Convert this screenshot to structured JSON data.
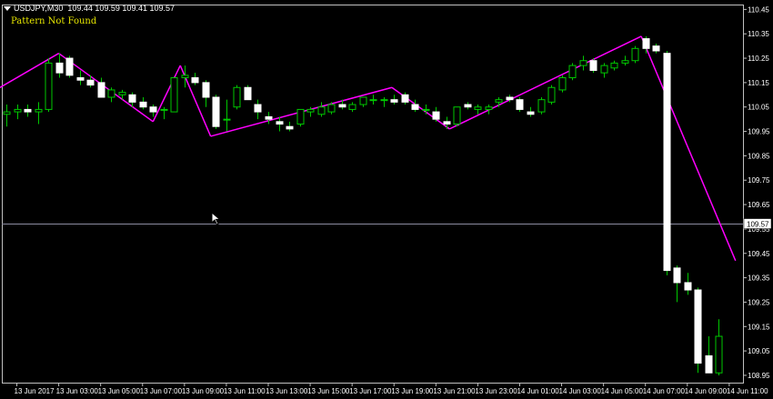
{
  "header": {
    "symbol": "USDJPY,M30",
    "ohlc": "109.44 109.59 109.41 109.57"
  },
  "indicator_status": {
    "text": "Pattern Not Found",
    "color": "#e6e600"
  },
  "colors": {
    "background": "#000000",
    "frame": "#c0c0c0",
    "bull_body": "#000000",
    "bull_outline": "#00c800",
    "bear_body": "#ffffff",
    "wick": "#00c800",
    "zigzag": "#ff00ff",
    "price_line": "#8c8ca0",
    "text": "#ffffff"
  },
  "chart_data": {
    "type": "candlestick",
    "symbol": "USDJPY",
    "timeframe": "M30",
    "ylim": [
      108.92,
      110.47
    ],
    "y_ticks": [
      110.45,
      110.35,
      110.25,
      110.15,
      110.05,
      109.95,
      109.85,
      109.75,
      109.65,
      109.55,
      109.45,
      109.35,
      109.25,
      109.15,
      109.05,
      108.95
    ],
    "y_tick_labels": [
      "110.45",
      "110.35",
      "110.25",
      "110.15",
      "110.05",
      "109.95",
      "109.85",
      "109.75",
      "109.65",
      "109.55",
      "109.45",
      "109.35",
      "109.25",
      "109.15",
      "109.05",
      "108.95"
    ],
    "x_tick_labels": [
      "13 Jun 2017",
      "13 Jun 03:00",
      "13 Jun 05:00",
      "13 Jun 07:00",
      "13 Jun 09:00",
      "13 Jun 11:00",
      "13 Jun 13:00",
      "13 Jun 15:00",
      "13 Jun 17:00",
      "13 Jun 19:00",
      "13 Jun 21:00",
      "13 Jun 23:00",
      "14 Jun 01:00",
      "14 Jun 03:00",
      "14 Jun 05:00",
      "14 Jun 07:00",
      "14 Jun 09:00",
      "14 Jun 11:00"
    ],
    "x_tick_bar_index": [
      1,
      5,
      9,
      13,
      17,
      21,
      25,
      29,
      33,
      37,
      41,
      45,
      49,
      53,
      57,
      61,
      65,
      69
    ],
    "current_price": 109.57,
    "current_price_label": "109.57",
    "candles": [
      {
        "o": 110.02,
        "h": 110.06,
        "l": 109.97,
        "c": 110.03
      },
      {
        "o": 110.03,
        "h": 110.06,
        "l": 110.0,
        "c": 110.04
      },
      {
        "o": 110.04,
        "h": 110.06,
        "l": 110.01,
        "c": 110.03
      },
      {
        "o": 110.03,
        "h": 110.07,
        "l": 109.98,
        "c": 110.04
      },
      {
        "o": 110.04,
        "h": 110.25,
        "l": 110.03,
        "c": 110.23
      },
      {
        "o": 110.23,
        "h": 110.27,
        "l": 110.17,
        "c": 110.19
      },
      {
        "o": 110.25,
        "h": 110.26,
        "l": 110.17,
        "c": 110.18
      },
      {
        "o": 110.17,
        "h": 110.2,
        "l": 110.14,
        "c": 110.16
      },
      {
        "o": 110.16,
        "h": 110.18,
        "l": 110.13,
        "c": 110.14
      },
      {
        "o": 110.15,
        "h": 110.17,
        "l": 110.09,
        "c": 110.09
      },
      {
        "o": 110.09,
        "h": 110.13,
        "l": 110.07,
        "c": 110.12
      },
      {
        "o": 110.1,
        "h": 110.12,
        "l": 110.08,
        "c": 110.11
      },
      {
        "o": 110.1,
        "h": 110.11,
        "l": 110.05,
        "c": 110.07
      },
      {
        "o": 110.07,
        "h": 110.09,
        "l": 110.04,
        "c": 110.05
      },
      {
        "o": 110.05,
        "h": 110.06,
        "l": 110.01,
        "c": 110.03
      },
      {
        "o": 110.04,
        "h": 110.05,
        "l": 110.0,
        "c": 110.04
      },
      {
        "o": 110.03,
        "h": 110.17,
        "l": 110.03,
        "c": 110.17
      },
      {
        "o": 110.17,
        "h": 110.22,
        "l": 110.13,
        "c": 110.18
      },
      {
        "o": 110.17,
        "h": 110.19,
        "l": 110.14,
        "c": 110.15
      },
      {
        "o": 110.15,
        "h": 110.16,
        "l": 110.05,
        "c": 110.09
      },
      {
        "o": 110.09,
        "h": 110.1,
        "l": 109.96,
        "c": 109.97
      },
      {
        "o": 110.0,
        "h": 110.08,
        "l": 109.95,
        "c": 110.0
      },
      {
        "o": 110.05,
        "h": 110.14,
        "l": 110.04,
        "c": 110.13
      },
      {
        "o": 110.13,
        "h": 110.14,
        "l": 110.08,
        "c": 110.08
      },
      {
        "o": 110.06,
        "h": 110.08,
        "l": 110.0,
        "c": 110.03
      },
      {
        "o": 110.01,
        "h": 110.03,
        "l": 109.98,
        "c": 110.0
      },
      {
        "o": 109.99,
        "h": 110.01,
        "l": 109.95,
        "c": 109.98
      },
      {
        "o": 109.97,
        "h": 109.99,
        "l": 109.95,
        "c": 109.96
      },
      {
        "o": 109.98,
        "h": 110.04,
        "l": 109.97,
        "c": 110.04
      },
      {
        "o": 110.03,
        "h": 110.05,
        "l": 110.01,
        "c": 110.04
      },
      {
        "o": 110.02,
        "h": 110.07,
        "l": 110.01,
        "c": 110.05
      },
      {
        "o": 110.03,
        "h": 110.07,
        "l": 110.02,
        "c": 110.06
      },
      {
        "o": 110.06,
        "h": 110.08,
        "l": 110.04,
        "c": 110.05
      },
      {
        "o": 110.04,
        "h": 110.07,
        "l": 110.03,
        "c": 110.06
      },
      {
        "o": 110.06,
        "h": 110.09,
        "l": 110.05,
        "c": 110.09
      },
      {
        "o": 110.08,
        "h": 110.1,
        "l": 110.06,
        "c": 110.08
      },
      {
        "o": 110.08,
        "h": 110.09,
        "l": 110.05,
        "c": 110.08
      },
      {
        "o": 110.08,
        "h": 110.1,
        "l": 110.06,
        "c": 110.07
      },
      {
        "o": 110.1,
        "h": 110.11,
        "l": 110.06,
        "c": 110.07
      },
      {
        "o": 110.06,
        "h": 110.08,
        "l": 110.03,
        "c": 110.04
      },
      {
        "o": 110.04,
        "h": 110.06,
        "l": 110.02,
        "c": 110.04
      },
      {
        "o": 110.03,
        "h": 110.05,
        "l": 109.99,
        "c": 110.0
      },
      {
        "o": 109.99,
        "h": 110.01,
        "l": 109.96,
        "c": 109.98
      },
      {
        "o": 109.98,
        "h": 110.05,
        "l": 109.97,
        "c": 110.05
      },
      {
        "o": 110.06,
        "h": 110.07,
        "l": 110.04,
        "c": 110.05
      },
      {
        "o": 110.04,
        "h": 110.06,
        "l": 110.02,
        "c": 110.05
      },
      {
        "o": 110.04,
        "h": 110.06,
        "l": 110.02,
        "c": 110.05
      },
      {
        "o": 110.07,
        "h": 110.09,
        "l": 110.05,
        "c": 110.08
      },
      {
        "o": 110.09,
        "h": 110.1,
        "l": 110.07,
        "c": 110.08
      },
      {
        "o": 110.08,
        "h": 110.09,
        "l": 110.03,
        "c": 110.04
      },
      {
        "o": 110.03,
        "h": 110.05,
        "l": 110.01,
        "c": 110.02
      },
      {
        "o": 110.03,
        "h": 110.09,
        "l": 110.02,
        "c": 110.08
      },
      {
        "o": 110.07,
        "h": 110.14,
        "l": 110.06,
        "c": 110.13
      },
      {
        "o": 110.12,
        "h": 110.18,
        "l": 110.11,
        "c": 110.17
      },
      {
        "o": 110.17,
        "h": 110.23,
        "l": 110.16,
        "c": 110.22
      },
      {
        "o": 110.22,
        "h": 110.26,
        "l": 110.2,
        "c": 110.24
      },
      {
        "o": 110.24,
        "h": 110.25,
        "l": 110.19,
        "c": 110.2
      },
      {
        "o": 110.19,
        "h": 110.23,
        "l": 110.17,
        "c": 110.22
      },
      {
        "o": 110.21,
        "h": 110.24,
        "l": 110.2,
        "c": 110.23
      },
      {
        "o": 110.23,
        "h": 110.26,
        "l": 110.22,
        "c": 110.24
      },
      {
        "o": 110.24,
        "h": 110.3,
        "l": 110.23,
        "c": 110.29
      },
      {
        "o": 110.33,
        "h": 110.34,
        "l": 110.27,
        "c": 110.29
      },
      {
        "o": 110.3,
        "h": 110.31,
        "l": 110.27,
        "c": 110.28
      },
      {
        "o": 110.27,
        "h": 110.28,
        "l": 109.36,
        "c": 109.38
      },
      {
        "o": 109.39,
        "h": 109.4,
        "l": 109.25,
        "c": 109.33
      },
      {
        "o": 109.33,
        "h": 109.37,
        "l": 109.28,
        "c": 109.3
      },
      {
        "o": 109.3,
        "h": 109.31,
        "l": 108.96,
        "c": 109.0
      },
      {
        "o": 109.03,
        "h": 109.11,
        "l": 108.96,
        "c": 108.96
      },
      {
        "o": 108.96,
        "h": 109.18,
        "l": 108.95,
        "c": 109.11
      }
    ],
    "zigzag": [
      {
        "i": -1,
        "price": 110.12
      },
      {
        "i": 5,
        "price": 110.27
      },
      {
        "i": 14,
        "price": 109.99
      },
      {
        "i": 16.6,
        "price": 110.22
      },
      {
        "i": 19.5,
        "price": 109.93
      },
      {
        "i": 36.8,
        "price": 110.13
      },
      {
        "i": 42.3,
        "price": 109.96
      },
      {
        "i": 60.6,
        "price": 110.34
      },
      {
        "i": 69.6,
        "price": 109.42
      }
    ]
  }
}
